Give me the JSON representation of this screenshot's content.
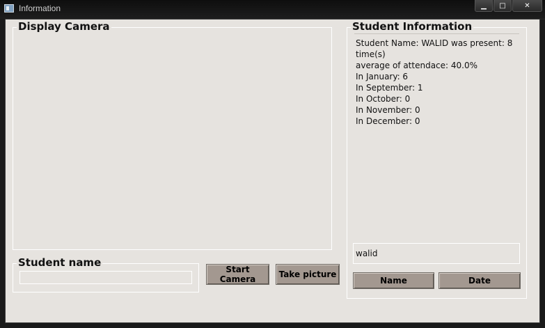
{
  "window": {
    "title": "Information",
    "minimize_glyph": "▁",
    "maximize_glyph": "□",
    "close_glyph": "✕"
  },
  "camera_panel": {
    "title": "Display Camera"
  },
  "student_name_panel": {
    "title": "Student name",
    "input_value": ""
  },
  "buttons": {
    "start_camera": "Start Camera",
    "take_picture": "Take picture",
    "name": "Name",
    "date": "Date"
  },
  "student_info": {
    "title": "Student Information",
    "lines": [
      "Student Name: WALID was present: 8",
      "time(s)",
      "average of attendace: 40.0%",
      "In January: 6",
      "In September: 1",
      "In October: 0",
      "In November: 0",
      "In December: 0"
    ],
    "search_value": "walid"
  },
  "colors": {
    "client_bg": "#e6e3df",
    "button_bg": "#a39890",
    "titlebar_bg": "#0e0e0e"
  }
}
